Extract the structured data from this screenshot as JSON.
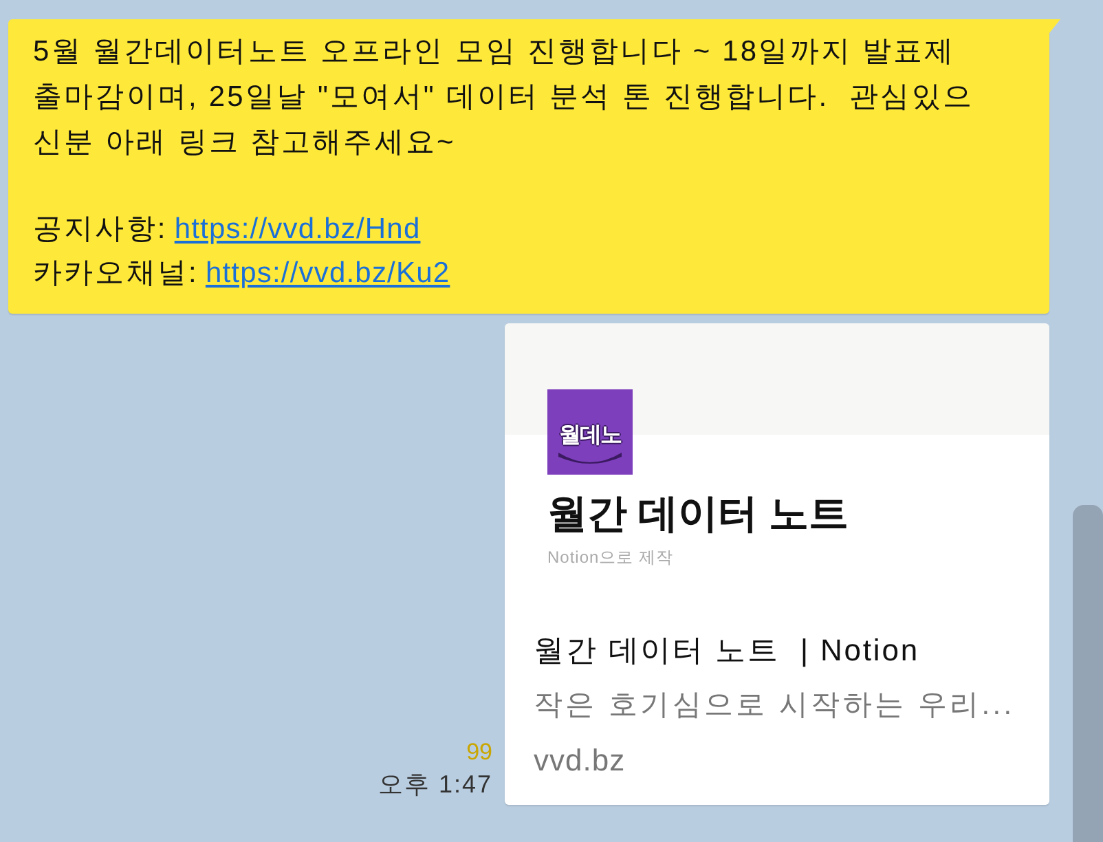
{
  "message": {
    "lines": [
      "5월 월간데이터노트 오프라인 모임 진행합니다 ~ 18일까지 발표제",
      "출마감이며, 25일날 \"모여서\" 데이터 분석 톤 진행합니다.  관심있으",
      "신분 아래 링크 참고해주세요~"
    ],
    "links": [
      {
        "label": "공지사항:",
        "url": "https://vvd.bz/Hnd"
      },
      {
        "label": "카카오채널:",
        "url": "https://vvd.bz/Ku2"
      }
    ]
  },
  "preview": {
    "logo_text": "월데노",
    "title": "월간 데이터 노트",
    "subtitle": "Notion으로 제작",
    "page_title": "월간 데이터 노트  | Notion",
    "description": "작은 호기심으로 시작하는 우리...",
    "domain": "vvd.bz"
  },
  "meta": {
    "unread_count": "99",
    "time": "오후 1:47"
  }
}
